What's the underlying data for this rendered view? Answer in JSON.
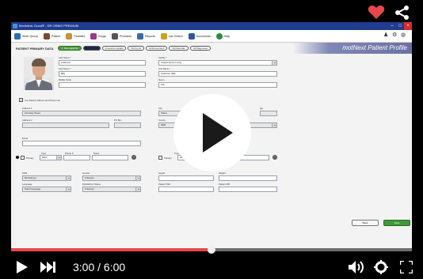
{
  "app": {
    "window_title": "Mediclinic Cloud® - DR ORBIS PREMIUM",
    "banner": "motNext Patient Profile",
    "menu": [
      {
        "label": "Work Queue",
        "color": "#2d6db5"
      },
      {
        "label": "Patient",
        "color": "#7a4a2a"
      },
      {
        "label": "Facilities",
        "color": "#c8903a"
      },
      {
        "label": "Drugs",
        "color": "#9a3a8a"
      },
      {
        "label": "Providers",
        "color": "#555555"
      },
      {
        "label": "Reports",
        "color": "#3a6aa8"
      },
      {
        "label": "Lab Orders",
        "color": "#c9a21e"
      },
      {
        "label": "Documents",
        "color": "#2a5a9a"
      },
      {
        "label": "Help",
        "color": "#2f8a3a"
      }
    ],
    "page_title": "PATIENT PRIMARY DATA",
    "tabs": [
      {
        "label": "1. Demographic"
      },
      {
        "label": ""
      },
      {
        "label": "Insurance details"
      },
      {
        "label": "All Forms"
      },
      {
        "label": "All Encounters"
      },
      {
        "label": "All Referrals"
      },
      {
        "label": "All Diagnoses"
      }
    ],
    "left": {
      "last_name_label": "Last Name *",
      "last_name": "Anderson",
      "first_name_label": "First Name *",
      "first_name": "Billy",
      "middle_label": "Middle Initial",
      "middle": "",
      "same_address_label": "Use Patient Address and Phone info",
      "address1_label": "Address 1",
      "address1": "123 Gray Street",
      "address2_label": "Address 2",
      "address2": "",
      "po_label": "PO Box",
      "po": "",
      "email_label": "Email",
      "email": "",
      "primary_label": "Primary",
      "type_label": "Type",
      "type": "Work",
      "phone_label": "Phone #",
      "phone": "",
      "notes_label": "Notes",
      "notes": "",
      "dob_label": "DOB",
      "dob": "Mm/dd/yyyy",
      "gender_label": "Gender",
      "gender": "Unknown",
      "language_label": "Language",
      "language": "Select language",
      "marital_label": "Marital/Civil Status",
      "marital": "Unknown"
    },
    "right": {
      "facility_label": "Facility *",
      "facility": "Independence Living",
      "unit_label": "Unit Name *",
      "unit": "Anderson, Billy",
      "room_label": "Room",
      "room": "110",
      "city_label": "City",
      "city": "Shave",
      "state_label": "State",
      "zip_label": "Zip",
      "zip": "",
      "county_label": "County",
      "county": "0000",
      "type_label": "Type",
      "type": "Work",
      "primary_label": "Primary",
      "height_label": "Height",
      "height": "",
      "weight_label": "Weight",
      "weight": "",
      "ssn_label": "Patient SSN",
      "ssn": "",
      "mrn_label": "Patient MR",
      "mrn": ""
    },
    "buttons": {
      "back": "Back",
      "save": "Save"
    }
  },
  "video": {
    "current_time": "3:00",
    "duration": "6:00",
    "time_display": "3:00 / 6:00",
    "progress_fraction": 0.5,
    "buffered_fraction": 0.5,
    "colors": {
      "progress": "#e8484a",
      "heart": "#e8484a"
    }
  }
}
